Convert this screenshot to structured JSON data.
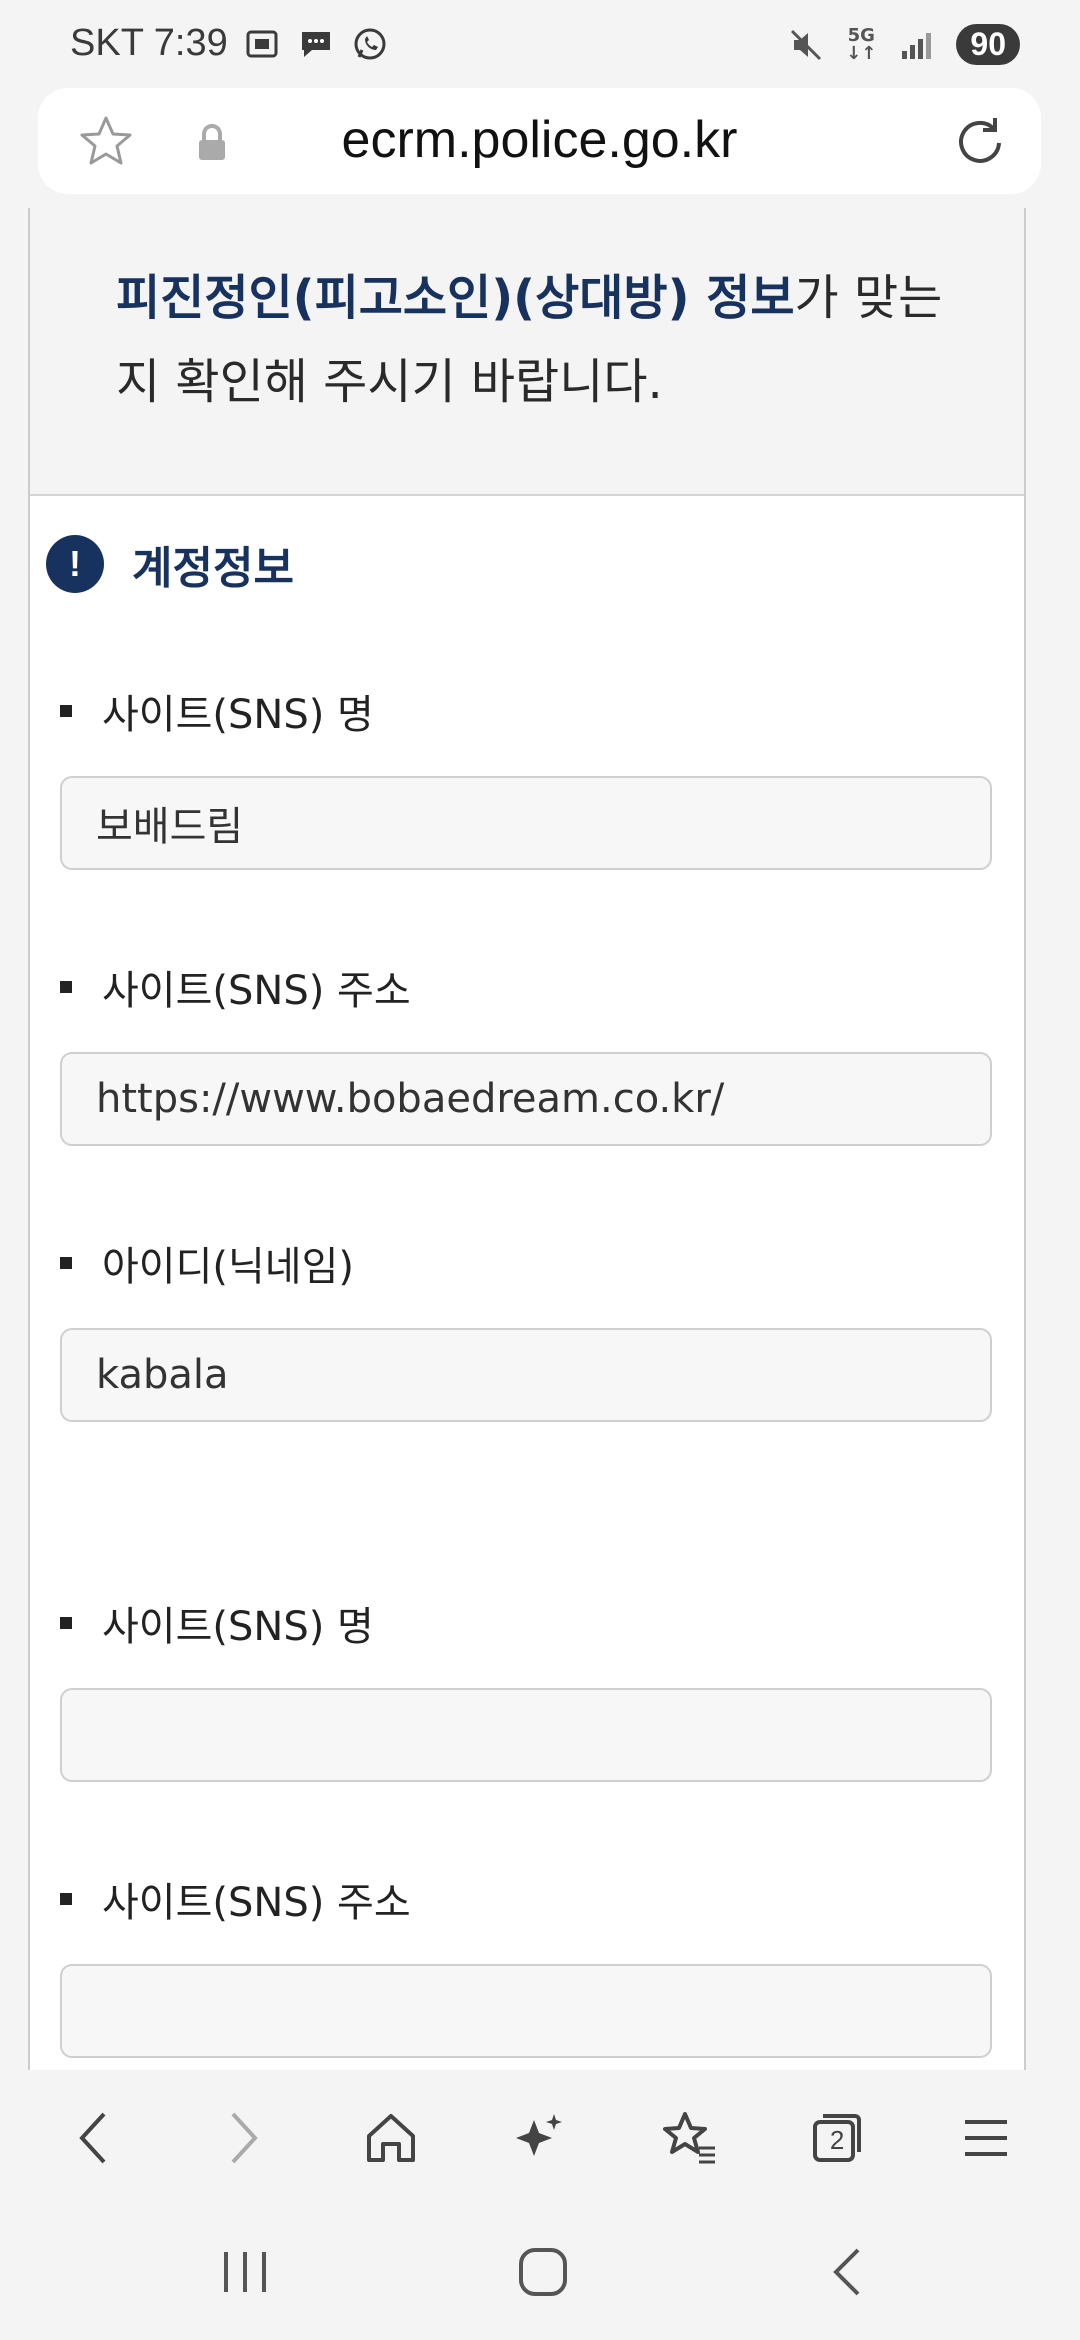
{
  "status_bar": {
    "carrier_time": "SKT 7:39",
    "network": "5G",
    "battery": "90"
  },
  "browser": {
    "url": "ecrm.police.go.kr"
  },
  "notice": {
    "highlight": "피진정인(피고소인)(상대방) 정보",
    "rest": "가 맞는지 확인해 주시기 바랍니다."
  },
  "section": {
    "title": "계정정보",
    "icon": "!"
  },
  "accounts": [
    {
      "site_name_label": "사이트(SNS) 명",
      "site_name_value": "보배드림",
      "site_url_label": "사이트(SNS) 주소",
      "site_url_value": "https://www.bobaedream.co.kr/",
      "user_id_label": "아이디(닉네임)",
      "user_id_value": "kabala"
    },
    {
      "site_name_label": "사이트(SNS) 명",
      "site_name_value": "",
      "site_url_label": "사이트(SNS) 주소",
      "site_url_value": ""
    }
  ],
  "toolbar": {
    "tab_count": "2"
  }
}
